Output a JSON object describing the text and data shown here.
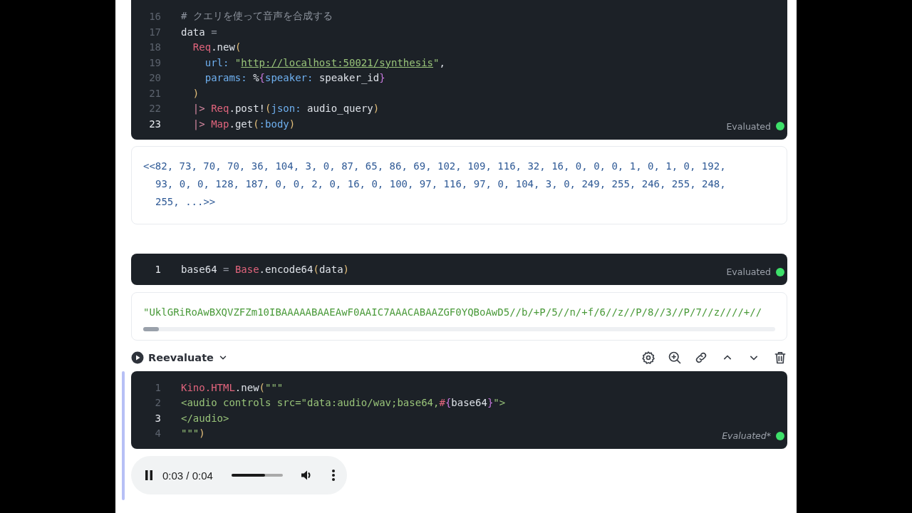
{
  "cells": [
    {
      "focused": false,
      "code": {
        "lines": [
          {
            "number": "16",
            "active": false,
            "tokens": [
              {
                "t": "# クエリを使って音声を合成する",
                "kind": "comment"
              }
            ]
          },
          {
            "number": "17",
            "active": false,
            "tokens": [
              {
                "t": "data",
                "kind": "plain"
              },
              {
                "t": " =",
                "kind": "op"
              }
            ]
          },
          {
            "number": "18",
            "active": false,
            "tokens": [
              {
                "t": "  Req",
                "kind": "module"
              },
              {
                "t": ".new",
                "kind": "plain"
              },
              {
                "t": "(",
                "kind": "paren"
              }
            ]
          },
          {
            "number": "19",
            "active": false,
            "tokens": [
              {
                "t": "    url:",
                "kind": "key"
              },
              {
                "t": " \"",
                "kind": "string"
              },
              {
                "t": "http://localhost:50021/synthesis",
                "kind": "link"
              },
              {
                "t": "\"",
                "kind": "string"
              },
              {
                "t": ",",
                "kind": "plain"
              }
            ]
          },
          {
            "number": "20",
            "active": false,
            "tokens": [
              {
                "t": "    params:",
                "kind": "key"
              },
              {
                "t": " %",
                "kind": "plain"
              },
              {
                "t": "{",
                "kind": "brace"
              },
              {
                "t": "speaker:",
                "kind": "key"
              },
              {
                "t": " speaker_id",
                "kind": "plain"
              },
              {
                "t": "}",
                "kind": "brace"
              }
            ]
          },
          {
            "number": "21",
            "active": false,
            "tokens": [
              {
                "t": "  )",
                "kind": "paren"
              }
            ]
          },
          {
            "number": "22",
            "active": false,
            "tokens": [
              {
                "t": "  |> ",
                "kind": "pipe"
              },
              {
                "t": "Req",
                "kind": "module"
              },
              {
                "t": ".post!",
                "kind": "plain"
              },
              {
                "t": "(",
                "kind": "paren"
              },
              {
                "t": "json:",
                "kind": "key"
              },
              {
                "t": " audio_query",
                "kind": "plain"
              },
              {
                "t": ")",
                "kind": "paren"
              }
            ]
          },
          {
            "number": "23",
            "active": true,
            "tokens": [
              {
                "t": "  |> ",
                "kind": "pipe"
              },
              {
                "t": "Map",
                "kind": "module"
              },
              {
                "t": ".get",
                "kind": "plain"
              },
              {
                "t": "(",
                "kind": "paren"
              },
              {
                "t": ":body",
                "kind": "atom"
              },
              {
                "t": ")",
                "kind": "paren"
              }
            ]
          }
        ]
      },
      "status": {
        "label": "Evaluated",
        "stale": false,
        "color": "#3ee06a"
      },
      "output": {
        "kind": "binary",
        "lines": [
          "<<82, 73, 70, 70, 36, 104, 3, 0, 87, 65, 86, 69, 102, 109, 116, 32, 16, 0, 0, 0, 1, 0, 1, 0, 192,",
          "93, 0, 0, 128, 187, 0, 0, 2, 0, 16, 0, 100, 97, 116, 97, 0, 104, 3, 0, 249, 255, 246, 255, 248,",
          "255, ...>>"
        ]
      }
    },
    {
      "focused": false,
      "code": {
        "lines": [
          {
            "number": "1",
            "active": true,
            "tokens": [
              {
                "t": "base64",
                "kind": "plain"
              },
              {
                "t": " = ",
                "kind": "op"
              },
              {
                "t": "Base",
                "kind": "module"
              },
              {
                "t": ".encode64",
                "kind": "plain"
              },
              {
                "t": "(",
                "kind": "paren"
              },
              {
                "t": "data",
                "kind": "plain"
              },
              {
                "t": ")",
                "kind": "paren"
              }
            ]
          }
        ]
      },
      "status": {
        "label": "Evaluated",
        "stale": false,
        "color": "#3ee06a"
      },
      "output": {
        "kind": "string",
        "text": "\"UklGRiRoAwBXQVZFZm10IBAAAAABAAEAwF0AAIC7AAACABAAZGF0YQBoAwD5//b/+P/5//n/+f/6//z//P/8//3//P/7//z////+//"
      }
    },
    {
      "focused": true,
      "toolbar": {
        "action": "Reevaluate"
      },
      "code": {
        "lines": [
          {
            "number": "1",
            "active": false,
            "tokens": [
              {
                "t": "Kino.HTML",
                "kind": "module"
              },
              {
                "t": ".new",
                "kind": "plain"
              },
              {
                "t": "(",
                "kind": "paren"
              },
              {
                "t": "\"\"\"",
                "kind": "string"
              }
            ]
          },
          {
            "number": "2",
            "active": false,
            "tokens": [
              {
                "t": "<audio controls src=\"data:audio/wav;base64,",
                "kind": "string"
              },
              {
                "t": "#",
                "kind": "module"
              },
              {
                "t": "{",
                "kind": "brace"
              },
              {
                "t": "base64",
                "kind": "plain"
              },
              {
                "t": "}",
                "kind": "brace"
              },
              {
                "t": "\">",
                "kind": "string"
              }
            ]
          },
          {
            "number": "3",
            "active": true,
            "tokens": [
              {
                "t": "</audio>",
                "kind": "string"
              }
            ]
          },
          {
            "number": "4",
            "active": false,
            "tokens": [
              {
                "t": "\"\"\"",
                "kind": "string"
              },
              {
                "t": ")",
                "kind": "paren"
              }
            ]
          }
        ]
      },
      "status": {
        "label": "Evaluated*",
        "stale": true,
        "color": "#3ee06a"
      },
      "output": {
        "kind": "audio",
        "playing": true,
        "time": "0:03 / 0:04",
        "level": 0.66
      }
    }
  ]
}
